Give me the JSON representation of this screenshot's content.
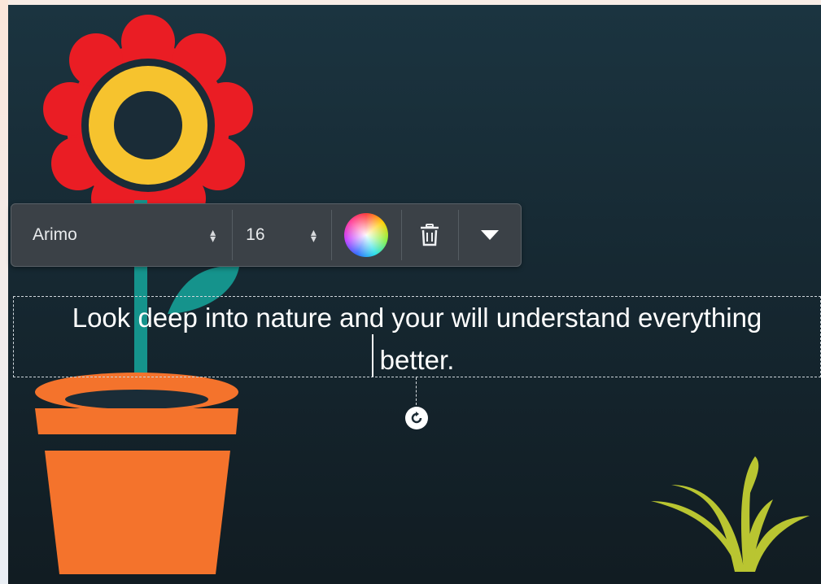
{
  "toolbar": {
    "font_value": "Arimo",
    "size_value": "16",
    "stepper_glyph": "⇕",
    "color_picker_icon": "color-wheel-icon",
    "delete_icon": "trash-icon",
    "more_icon": "caret-down-icon"
  },
  "text_box": {
    "line1": "Look deep into nature and your will understand everything",
    "line2": "better."
  },
  "colors": {
    "background": "#15262f",
    "petals": "#ea1d24",
    "flower_ring": "#f6c32e",
    "stem": "#15938c",
    "pot": "#f4732c",
    "grass": "#b9c531"
  }
}
